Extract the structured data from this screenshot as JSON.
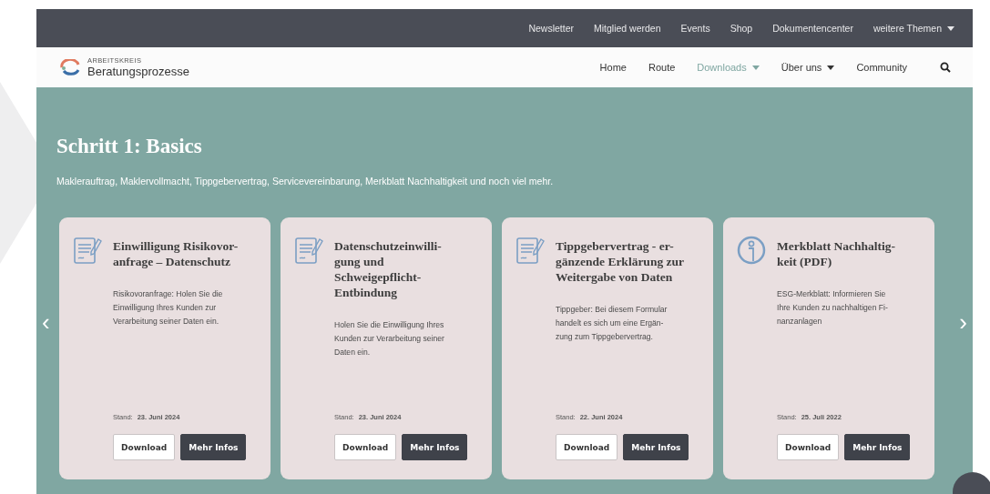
{
  "top_bar": {
    "links": [
      {
        "label": "Newsletter",
        "dropdown": false
      },
      {
        "label": "Mitglied werden",
        "dropdown": false
      },
      {
        "label": "Events",
        "dropdown": false
      },
      {
        "label": "Shop",
        "dropdown": false
      },
      {
        "label": "Dokumentencenter",
        "dropdown": false
      },
      {
        "label": "weitere Themen",
        "dropdown": true
      }
    ]
  },
  "header": {
    "logo": {
      "overline": "ARBEITSKREIS",
      "name": "Beratungsprozesse"
    },
    "nav": [
      {
        "label": "Home",
        "selected": false,
        "dropdown": false
      },
      {
        "label": "Route",
        "selected": false,
        "dropdown": false
      },
      {
        "label": "Downloads",
        "selected": true,
        "dropdown": true
      },
      {
        "label": "Über uns",
        "selected": false,
        "dropdown": true
      },
      {
        "label": "Community",
        "selected": false,
        "dropdown": false
      }
    ]
  },
  "hero": {
    "title": "Schritt 1: Basics",
    "subtitle": "Maklerauftrag, Maklervollmacht, Tippgebervertrag, Servicevereinbarung, Merkblatt Nachhaltigkeit und noch viel mehr."
  },
  "cards": [
    {
      "kind": "document",
      "title": "Einwilligung Risikovor-\nanfrage – Datenschutz",
      "description": "Risikovoranfrage: Holen Sie die\nEinwilligung Ihres Kunden zur\nVerarbeitung seiner Daten ein.",
      "date_label": "Stand:",
      "date": "23. Juni 2024",
      "buttons": [
        "Download",
        "Mehr Infos"
      ]
    },
    {
      "kind": "document",
      "title": "Datenschutzeinwilli-\ngung und\nSchweigepflicht-\nEntbindung",
      "description": "Holen Sie die Einwilligung Ihres\nKunden zur Verarbeitung seiner\nDaten ein.",
      "date_label": "Stand:",
      "date": "23. Juni 2024",
      "buttons": [
        "Download",
        "Mehr Infos"
      ]
    },
    {
      "kind": "document",
      "title": "Tippgebervertrag - er-\ngänzende Erklärung zur\nWeitergabe von Daten",
      "description": "Tippgeber: Bei diesem Formular\nhandelt es sich um eine Ergän-\nzung zum Tippgebervertrag.",
      "date_label": "Stand:",
      "date": "22. Juni 2024",
      "buttons": [
        "Download",
        "Mehr Infos"
      ]
    },
    {
      "kind": "info",
      "title": "Merkblatt Nachhaltig-\nkeit (PDF)",
      "description": "ESG-Merkblatt: Informieren Sie\nIhre Kunden zu nachhaltigen Fi-\nnanzanlagen",
      "date_label": "Stand:",
      "date": "25. Juli 2022",
      "buttons": [
        "Download",
        "Mehr Infos"
      ]
    }
  ],
  "carousel": {
    "prev": "‹",
    "next": "›"
  }
}
